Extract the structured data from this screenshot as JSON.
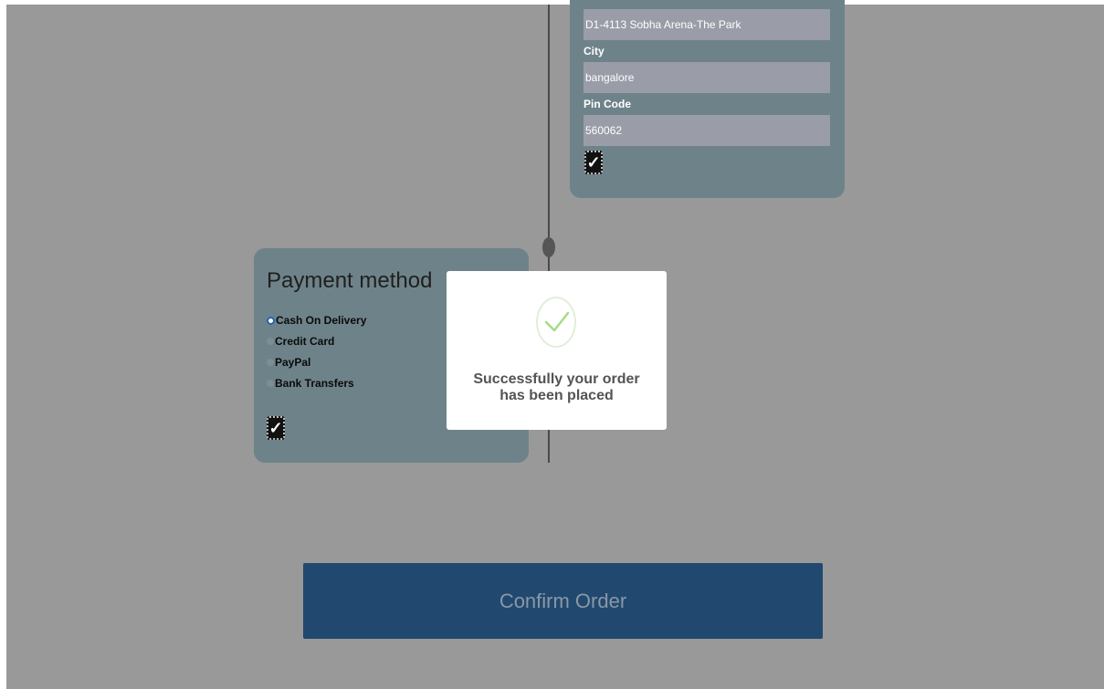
{
  "address": {
    "address_value": "D1-4113 Sobha Arena-The Park",
    "city_label": "City",
    "city_value": "bangalore",
    "pin_label": "Pin Code",
    "pin_value": "560062",
    "checkbox_mark": "✓"
  },
  "payment": {
    "title": "Payment method",
    "options": [
      {
        "label": "Cash On Delivery",
        "selected": true
      },
      {
        "label": "Credit Card",
        "selected": false
      },
      {
        "label": "PayPal",
        "selected": false
      },
      {
        "label": "Bank Transfers",
        "selected": false
      }
    ],
    "checkbox_mark": "✓"
  },
  "confirm_button": {
    "label": "Confirm Order"
  },
  "modal": {
    "icon": "check-icon",
    "message": "Successfully your order has been placed"
  },
  "colors": {
    "overlay_bg": "#999999",
    "card_bg": "#6e8389",
    "confirm_button_bg": "#21496f",
    "success_check": "#a5dc86"
  }
}
